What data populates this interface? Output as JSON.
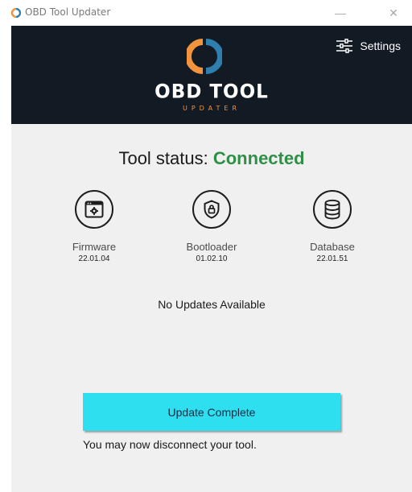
{
  "window": {
    "title": "OBD Tool Updater",
    "minimize_glyph": "—",
    "close_glyph": "✕",
    "icon": "app-logo-icon"
  },
  "header": {
    "logo_title": "OBD TOOL",
    "logo_subtitle": "UPDATER",
    "settings_label": "Settings",
    "settings_icon": "sliders-icon",
    "colors": {
      "background": "#121a24",
      "logo_orange": "#f2943d",
      "logo_blue": "#2f7fae"
    }
  },
  "status": {
    "label": "Tool status:",
    "value": "Connected",
    "value_color": "#2f8f46"
  },
  "components": [
    {
      "name": "Firmware",
      "version": "22.01.04",
      "icon": "firmware-window-gear-icon"
    },
    {
      "name": "Bootloader",
      "version": "01.02.10",
      "icon": "shield-lock-icon"
    },
    {
      "name": "Database",
      "version": "22.01.51",
      "icon": "database-icon"
    }
  ],
  "message": "No Updates Available",
  "update_button": {
    "label": "Update Complete",
    "color": "#2ee0ef"
  },
  "disconnect_note": "You may now disconnect your tool."
}
